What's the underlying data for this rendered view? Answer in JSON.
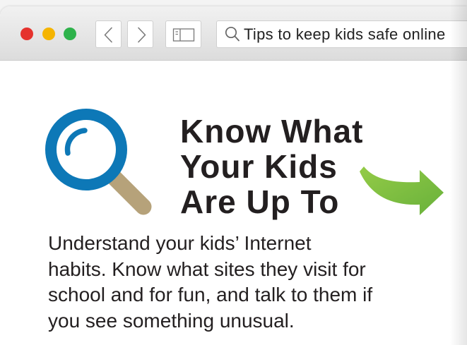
{
  "browser": {
    "window_controls": {
      "close_color": "#e5322d",
      "minimize_color": "#f5b400",
      "zoom_color": "#2eb24b"
    },
    "back_icon": "chevron-left-icon",
    "forward_icon": "chevron-right-icon",
    "sidebar_icon": "sidebar-icon",
    "search": {
      "icon": "search-icon",
      "query": "Tips to keep kids safe online"
    }
  },
  "content": {
    "illustration_icon": "magnifying-glass-icon",
    "heading_lines": [
      "Know What",
      "Your Kids",
      "Are Up To"
    ],
    "arrow_icon": "arrow-right-icon",
    "body_lines": [
      "Understand your kids’ Internet",
      "habits. Know what sites they visit for",
      "school and for fun, and talk to them if",
      "you see something unusual."
    ]
  },
  "colors": {
    "magnifier_blue": "#0d78b7",
    "magnifier_handle": "#b6a27a",
    "arrow_green_light": "#94cb47",
    "arrow_green_dark": "#68b13b",
    "text": "#231f20"
  }
}
